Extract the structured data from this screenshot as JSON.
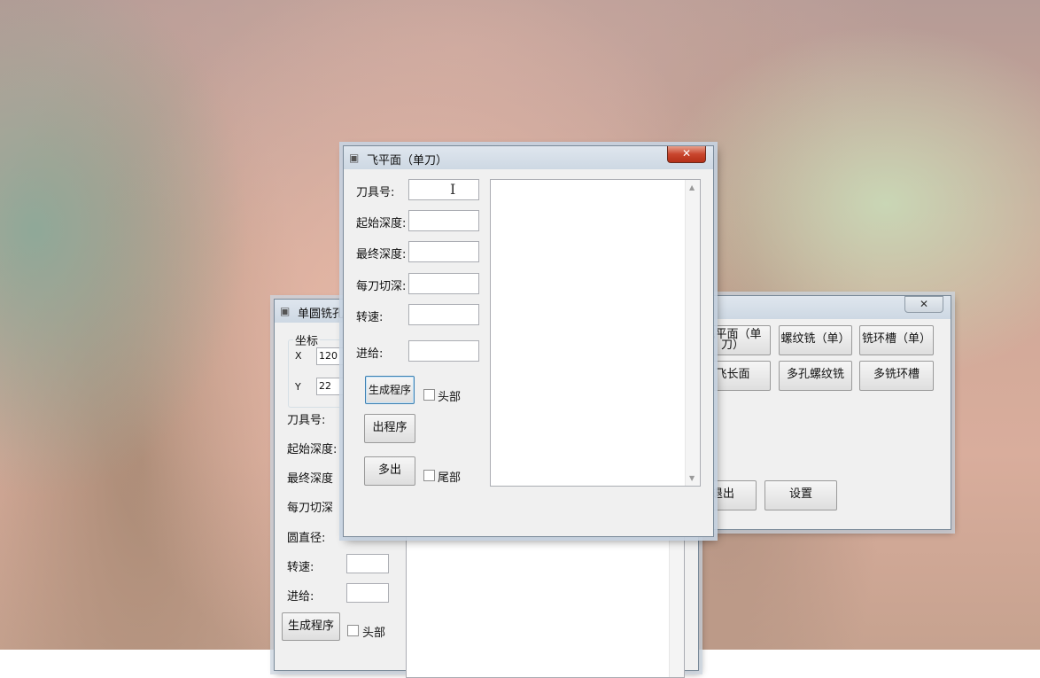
{
  "main_window": {
    "buttons": [
      "飞平面（单刀）",
      "螺纹铣（单）",
      "铣环槽（单）",
      "飞长面",
      "多孔螺纹铣",
      "多铣环槽"
    ],
    "exit_label": "退出",
    "settings_label": "设置",
    "close_glyph": "✕"
  },
  "back_window": {
    "title": "单圆铣孔",
    "group_title": "坐标",
    "x_label": "X",
    "x_value": "120",
    "y_label": "Y",
    "y_value": "22",
    "labels": {
      "tool": "刀具号:",
      "start_depth": "起始深度:",
      "final_depth": "最终深度",
      "cut_depth": "每刀切深",
      "diameter": "圆直径:",
      "speed": "转速:",
      "feed": "进给:"
    },
    "generate_label": "生成程序",
    "head_label": "头部"
  },
  "front_window": {
    "title": "飞平面（单刀）",
    "close_glyph": "✕",
    "labels": {
      "tool": "刀具号:",
      "start_depth": "起始深度:",
      "final_depth": "最终深度:",
      "cut_depth": "每刀切深:",
      "speed": "转速:",
      "feed": "进给:"
    },
    "values": {
      "tool": "",
      "start_depth": "",
      "final_depth": "",
      "cut_depth": "",
      "speed": "",
      "feed": ""
    },
    "generate_label": "生成程序",
    "output_label": "出程序",
    "multi_label": "多出",
    "head_label": "头部",
    "tail_label": "尾部",
    "program_text": ""
  },
  "icons": {
    "app": "window-app-icon",
    "close": "close-icon",
    "text_cursor": "text-cursor-icon",
    "scroll_up": "scroll-up-icon",
    "scroll_down": "scroll-down-icon"
  }
}
